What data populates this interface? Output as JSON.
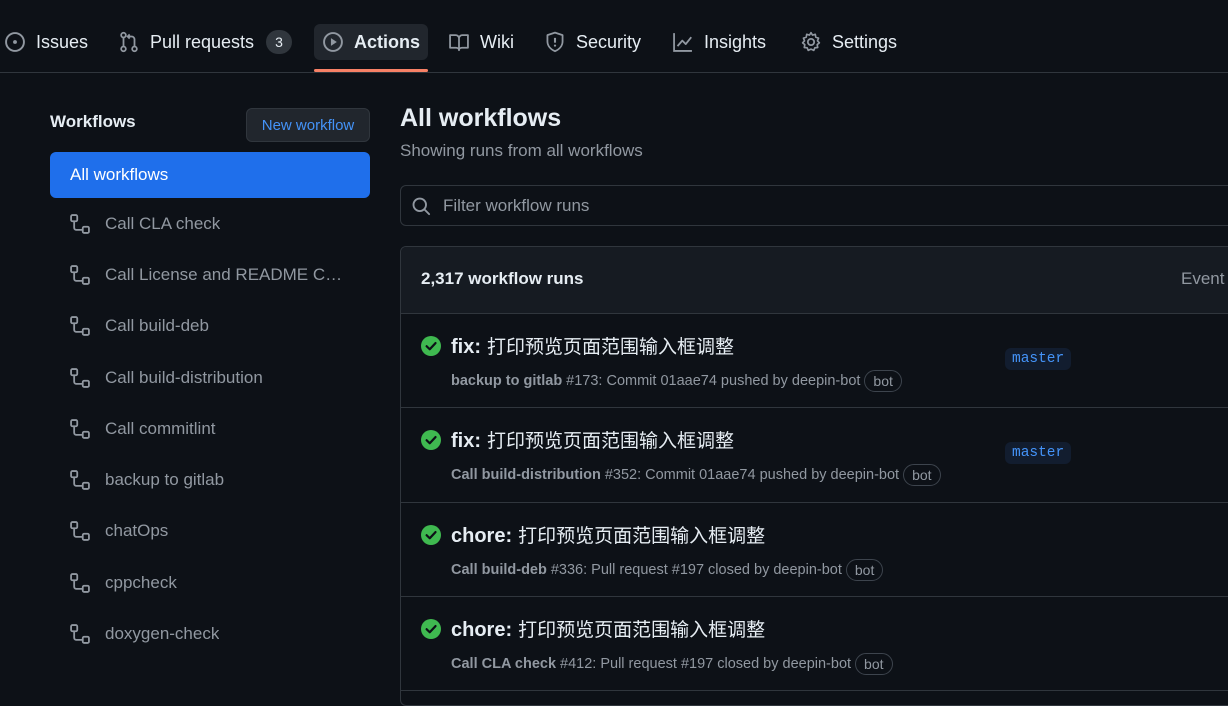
{
  "nav": {
    "items": [
      {
        "label": "Issues",
        "icon": "issue-opened-icon"
      },
      {
        "label": "Pull requests",
        "icon": "git-pull-request-icon",
        "count": "3"
      },
      {
        "label": "Actions",
        "icon": "play-icon",
        "active": true
      },
      {
        "label": "Wiki",
        "icon": "book-icon"
      },
      {
        "label": "Security",
        "icon": "shield-icon"
      },
      {
        "label": "Insights",
        "icon": "graph-icon"
      },
      {
        "label": "Settings",
        "icon": "gear-icon"
      }
    ]
  },
  "sidebar": {
    "title": "Workflows",
    "new_button": "New workflow",
    "active_item": "All workflows",
    "items": [
      {
        "label": "Call CLA check"
      },
      {
        "label": "Call License and README C…"
      },
      {
        "label": "Call build-deb"
      },
      {
        "label": "Call build-distribution"
      },
      {
        "label": "Call commitlint"
      },
      {
        "label": "backup to gitlab"
      },
      {
        "label": "chatOps"
      },
      {
        "label": "cppcheck"
      },
      {
        "label": "doxygen-check"
      }
    ]
  },
  "main": {
    "title": "All workflows",
    "subtitle": "Showing runs from all workflows",
    "filter_placeholder": "Filter workflow runs",
    "runs_count": "2,317 workflow runs",
    "event_label": "Event",
    "runs": [
      {
        "status": "success",
        "kind": "fix:",
        "message": " 打印预览页面范围输入框调整",
        "workflow": "backup to gitlab",
        "detail": "#173: Commit 01aae74 pushed by deepin-bot",
        "badge": "bot",
        "branch": "master"
      },
      {
        "status": "success",
        "kind": "fix:",
        "message": " 打印预览页面范围输入框调整",
        "workflow": "Call build-distribution",
        "detail": "#352: Commit 01aae74 pushed by deepin-bot",
        "badge": "bot",
        "branch": "master"
      },
      {
        "status": "success",
        "kind": "chore:",
        "message": " 打印预览页面范围输入框调整",
        "workflow": "Call build-deb",
        "detail": "#336: Pull request #197 closed by deepin-bot",
        "badge": "bot",
        "branch": ""
      },
      {
        "status": "success",
        "kind": "chore:",
        "message": " 打印预览页面范围输入框调整",
        "workflow": "Call CLA check",
        "detail": "#412: Pull request #197 closed by deepin-bot",
        "badge": "bot",
        "branch": ""
      }
    ]
  },
  "colors": {
    "accent": "#1f6feb",
    "link": "#4493f8",
    "success": "#3fb950",
    "underline": "#f78166"
  }
}
